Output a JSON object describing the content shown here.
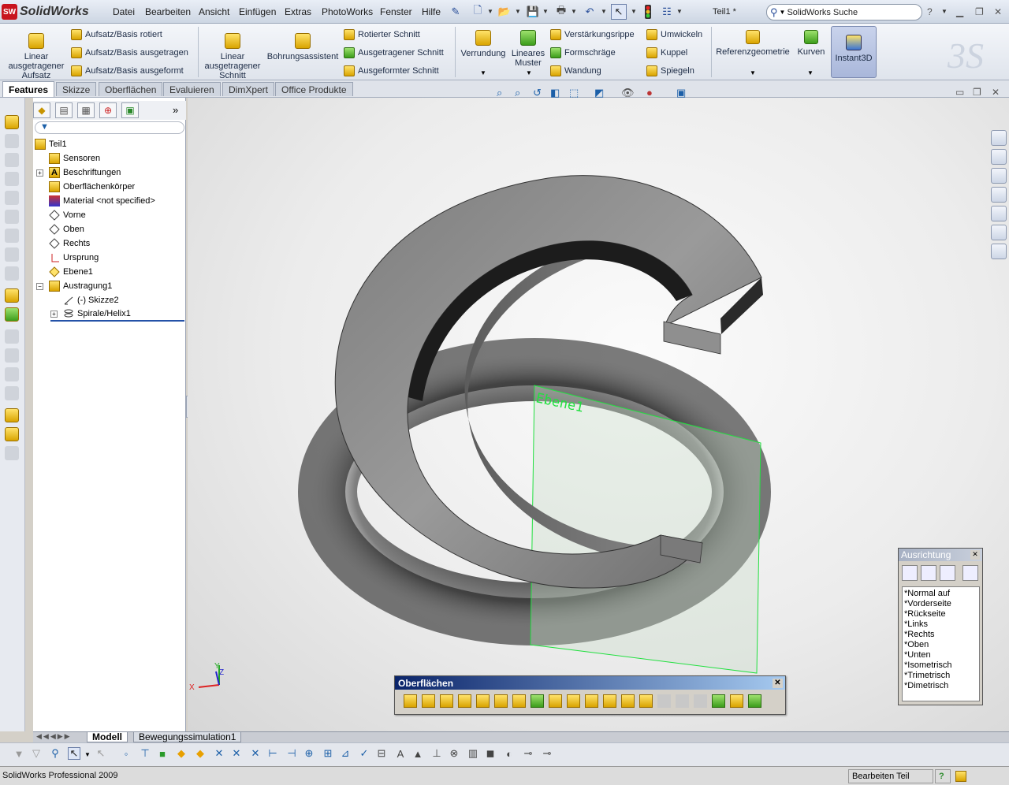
{
  "app": {
    "name": "SolidWorks",
    "logo_badge": "SW",
    "document_title": "Teil1 *",
    "search_placeholder": "SolidWorks Suche"
  },
  "menu": [
    "Datei",
    "Bearbeiten",
    "Ansicht",
    "Einfügen",
    "Extras",
    "PhotoWorks",
    "Fenster",
    "Hilfe"
  ],
  "commands": {
    "linear_boss": "Linear\nausgetragener\nAufsatz",
    "revolved_boss": "Aufsatz/Basis rotiert",
    "swept_boss": "Aufsatz/Basis ausgetragen",
    "lofted_boss": "Aufsatz/Basis ausgeformt",
    "linear_cut": "Linear\nausgetragener\nSchnitt",
    "hole_wizard": "Bohrungsassistent",
    "revolved_cut": "Rotierter Schnitt",
    "swept_cut": "Ausgetragener Schnitt",
    "lofted_cut": "Ausgeformter Schnitt",
    "fillet": "Verrundung",
    "linear_pattern": "Lineares\nMuster",
    "rib": "Verstärkungsrippe",
    "draft": "Formschräge",
    "shell": "Wandung",
    "wrap": "Umwickeln",
    "dome": "Kuppel",
    "mirror": "Spiegeln",
    "ref_geometry": "Referenzgeometrie",
    "curves": "Kurven",
    "instant3d": "Instant3D"
  },
  "tabs": [
    "Features",
    "Skizze",
    "Oberflächen",
    "Evaluieren",
    "DimXpert",
    "Office Produkte"
  ],
  "tree": [
    {
      "label": "Teil1",
      "icon": "part-icon"
    },
    {
      "label": "Sensoren",
      "icon": "sensor-icon"
    },
    {
      "label": "Beschriftungen",
      "icon": "annotation-icon"
    },
    {
      "label": "Oberflächenkörper",
      "icon": "surface-bodies-icon"
    },
    {
      "label": "Material <not specified>",
      "icon": "material-icon"
    },
    {
      "label": "Vorne",
      "icon": "plane-icon"
    },
    {
      "label": "Oben",
      "icon": "plane-icon"
    },
    {
      "label": "Rechts",
      "icon": "plane-icon"
    },
    {
      "label": "Ursprung",
      "icon": "origin-icon"
    },
    {
      "label": "Ebene1",
      "icon": "plane-icon"
    },
    {
      "label": "Austragung1",
      "icon": "sweep-icon"
    },
    {
      "label": "(-) Skizze2",
      "icon": "sketch-icon"
    },
    {
      "label": "Spirale/Helix1",
      "icon": "helix-icon"
    }
  ],
  "viewport": {
    "plane_label": "Ebene1",
    "triad_x": "X",
    "triad_y": "Y",
    "triad_z": "Z"
  },
  "surfaces_toolbar": {
    "title": "Oberflächen"
  },
  "orientation": {
    "title": "Ausrichtung",
    "views": [
      "*Normal auf",
      "*Vorderseite",
      "*Rückseite",
      "*Links",
      "*Rechts",
      "*Oben",
      "*Unten",
      "*Isometrisch",
      "*Trimetrisch",
      "*Dimetrisch"
    ]
  },
  "bottom_tabs": [
    "Modell",
    "Bewegungssimulation1"
  ],
  "status": {
    "product": "SolidWorks Professional 2009",
    "mode": "Bearbeiten Teil",
    "help": "?"
  },
  "colors": {
    "accent": "#0a246a",
    "plane": "#22e040",
    "part": "#8a8a8a"
  }
}
